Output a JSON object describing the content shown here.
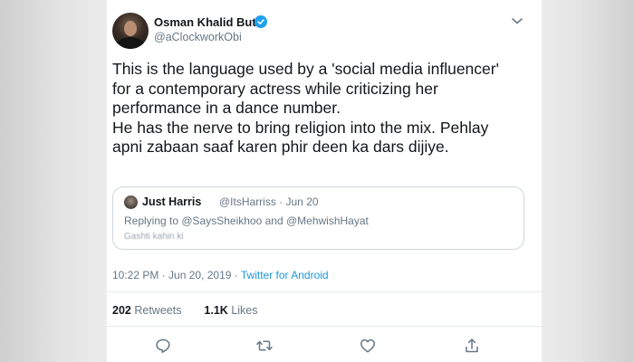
{
  "tweet": {
    "author_name": "Osman Khalid Butt",
    "author_handle": "@aClockworkObi",
    "text_lines": [
      "This is the language used by a 'social media influencer'",
      "for a contemporary actress while criticizing her",
      "performance in a dance number.",
      "He has the nerve to bring religion into the mix. Pehlay",
      "apni zabaan saaf karen phir deen ka dars dijiye."
    ],
    "timestamp": "10:22 PM · Jun 20, 2019 · ",
    "source": "Twitter for Android",
    "retweets_count": "202",
    "retweets_label": "Retweets",
    "likes_count": "1.1K",
    "likes_label": "Likes"
  },
  "quoted_tweet": {
    "author_name": "Just Harris",
    "author_meta": "@ItsHarriss · Jun 20",
    "replying_prefix": "Replying to ",
    "mention_1": "@SaysSheikhoo",
    "replying_and": " and ",
    "mention_2": "@MehwishHayat",
    "text": "Gashti kahin ki"
  },
  "icons": {
    "verified": "verified-badge-icon",
    "more": "chevron-down-icon",
    "reply": "reply-icon",
    "retweet": "retweet-icon",
    "like": "heart-icon",
    "share": "share-icon"
  },
  "colors": {
    "accent": "#1da1f2",
    "link": "#1b95e0",
    "secondary_text": "#657786",
    "primary_text": "#14171a"
  }
}
